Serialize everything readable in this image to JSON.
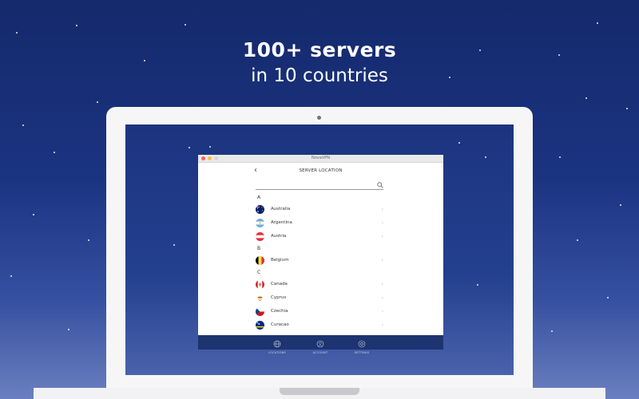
{
  "headline": {
    "line1": "100+ servers",
    "line2": "in 10 countries"
  },
  "window": {
    "title": "NovaVPN"
  },
  "page": {
    "title": "SERVER LOCATION",
    "back_icon": "chevron-left-icon",
    "search_icon": "search-icon"
  },
  "groups": [
    {
      "letter": "A",
      "countries": [
        "Australia",
        "Argentina",
        "Austria"
      ]
    },
    {
      "letter": "B",
      "countries": [
        "Belgium"
      ]
    },
    {
      "letter": "C",
      "countries": [
        "Canada",
        "Cyprus",
        "Czechia",
        "Curacao"
      ]
    }
  ],
  "nav": [
    {
      "label": "LOCATIONS",
      "icon": "globe-icon"
    },
    {
      "label": "ACCOUNT",
      "icon": "user-icon"
    },
    {
      "label": "SETTINGS",
      "icon": "gear-icon"
    }
  ],
  "colors": {
    "nav": "#1d3470",
    "background_top": "#15296b",
    "background_bottom": "#6b7fbf",
    "close": "#fc605c",
    "minimize": "#fdbc40",
    "zoom": "#d6d6d6"
  }
}
